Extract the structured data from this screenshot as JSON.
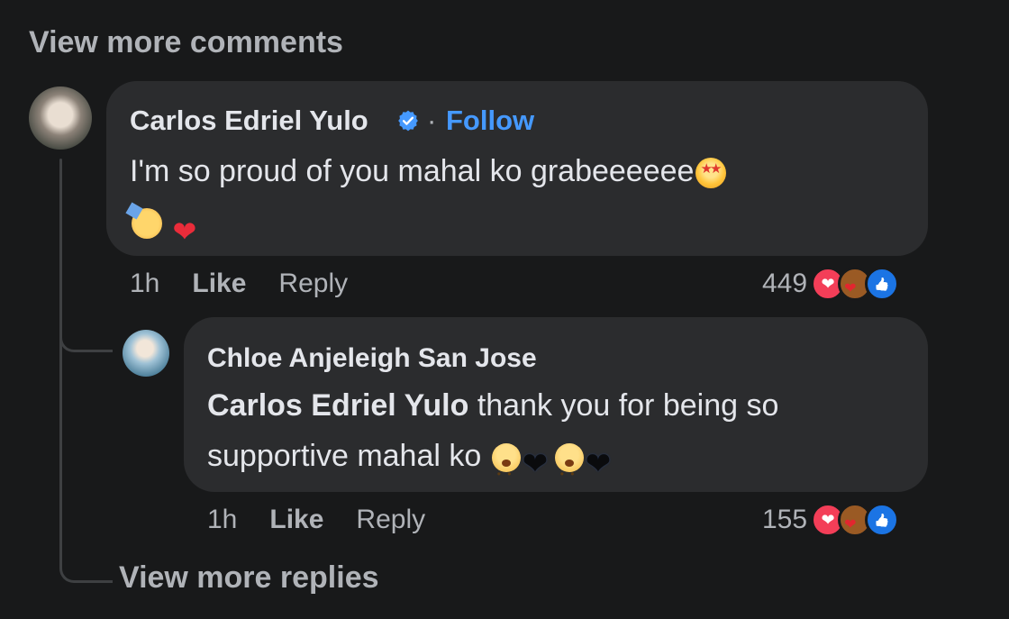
{
  "top": {
    "view_more_comments": "View more comments"
  },
  "comment": {
    "author": "Carlos Edriel Yulo",
    "separator": "·",
    "follow": "Follow",
    "text": "I'm so proud of you mahal ko grabeeeeee",
    "emojis_inline": [
      "star-struck-emoji"
    ],
    "emojis_line2": [
      "partying-face-emoji",
      "red-heart-emoji"
    ],
    "time": "1h",
    "like": "Like",
    "reply": "Reply",
    "reaction_count": "449",
    "reactions": [
      "love-icon",
      "care-icon",
      "like-icon"
    ]
  },
  "reply": {
    "author": "Chloe Anjeleigh San Jose",
    "mention": "Carlos Edriel Yulo",
    "text_after_mention": " thank you for being so supportive mahal ko",
    "emojis": [
      "pleading-face-emoji",
      "black-heart-emoji",
      "pleading-face-emoji",
      "black-heart-emoji"
    ],
    "time": "1h",
    "like": "Like",
    "reply": "Reply",
    "reaction_count": "155",
    "reactions": [
      "love-icon",
      "care-icon",
      "like-icon"
    ]
  },
  "footer": {
    "view_more_replies": "View more replies"
  },
  "colors": {
    "background": "#18191a",
    "bubble": "#2b2c2e",
    "link": "#4599ff",
    "muted": "#b0b3b8",
    "text": "#e4e6eb"
  }
}
